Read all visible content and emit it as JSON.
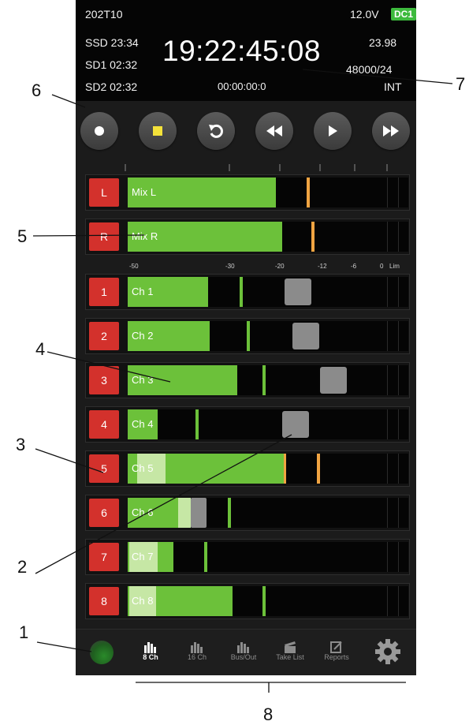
{
  "status": {
    "project": "202T10",
    "voltage": "12.0V",
    "power_badge": "DC1",
    "ssd": "SSD 23:34",
    "sd1": "SD1 02:32",
    "sd2": "SD2 02:32",
    "timecode": "19:22:45:08",
    "frame_rate": "23.98",
    "sample_format": "48000/24",
    "counter": "00:00:00:0",
    "sync_source": "INT"
  },
  "transport": {
    "icons": [
      "record-icon",
      "stop-icon",
      "loop-icon",
      "rewind-icon",
      "play-icon",
      "fast-forward-icon"
    ]
  },
  "meters": {
    "mix": [
      {
        "button": "L",
        "label": "Mix L"
      },
      {
        "button": "R",
        "label": "Mix R"
      }
    ],
    "scale": [
      "-50",
      "-30",
      "-20",
      "-12",
      "-6",
      "0",
      "Lim"
    ],
    "channels": [
      {
        "button": "1",
        "label": "Ch 1"
      },
      {
        "button": "2",
        "label": "Ch 2"
      },
      {
        "button": "3",
        "label": "Ch 3"
      },
      {
        "button": "4",
        "label": "Ch 4"
      },
      {
        "button": "5",
        "label": "Ch 5"
      },
      {
        "button": "6",
        "label": "Ch 6"
      },
      {
        "button": "7",
        "label": "Ch 7"
      },
      {
        "button": "8",
        "label": "Ch 8"
      }
    ]
  },
  "tabs": [
    {
      "label": "8 Ch",
      "active": true
    },
    {
      "label": "16 Ch"
    },
    {
      "label": "Bus/Out"
    },
    {
      "label": "Take List"
    },
    {
      "label": "Reports"
    }
  ],
  "callouts": [
    "1",
    "2",
    "3",
    "4",
    "5",
    "6",
    "7",
    "8"
  ],
  "colors": {
    "accent_green": "#6cc13a",
    "channel_red": "#d3312c",
    "peak_orange": "#f0a442",
    "badge_green": "#3dba3d"
  }
}
